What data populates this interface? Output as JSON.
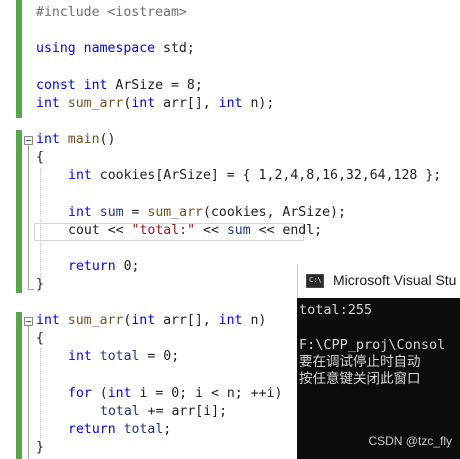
{
  "editor": {
    "lines": {
      "l1_pp": "#include <iostream>",
      "l3_kw": "using namespace",
      "l3_rest": " std;",
      "l5_kw1": "const",
      "l5_kw2": "int",
      "l5_rest": " ArSize = 8;",
      "l6_kw": "int",
      "l6_fn": "sum_arr",
      "l6_p1": "(",
      "l6_kw2": "int",
      "l6_p2": " arr[], ",
      "l6_kw3": "int",
      "l6_p3": " n);",
      "main_kw": "int",
      "main_fn": "main",
      "main_p": "()",
      "brace_open": "{",
      "c1_kw": "int",
      "c1_rest": " cookies[ArSize] = { 1,2,4,8,16,32,64,128 };",
      "c2_kw": "int",
      "c2_id": " sum",
      "c2_p1": " = ",
      "c2_fn": "sum_arr",
      "c2_p2": "(cookies, ArSize);",
      "c3_a": "cout << ",
      "c3_str": "\"total:\"",
      "c3_b": " << ",
      "c3_id": "sum",
      "c3_c": " << endl;",
      "c4_kw": "return",
      "c4_rest": " 0;",
      "brace_close": "}",
      "f_kw": "int",
      "f_fn": "sum_arr",
      "f_p1": "(",
      "f_kw2": "int",
      "f_p2": " arr[], ",
      "f_kw3": "int",
      "f_p3": " n)",
      "f1_kw": "int",
      "f1_id": " total",
      "f1_rest": " = 0;",
      "f2_kw": "for",
      "f2_p1": " (",
      "f2_kw2": "int",
      "f2_rest": " i = 0; i < n; ++i)",
      "f3_id": "total",
      "f3_rest": " += arr[i];",
      "f4_kw": "return",
      "f4_id": " total",
      "f4_rest": ";"
    }
  },
  "console": {
    "title": "Microsoft Visual Stu",
    "output_line1": "total:255",
    "output_line2": "F:\\CPP_proj\\Consol",
    "output_line3": "要在调试停止时自动",
    "output_line4": "按任意键关闭此窗口"
  },
  "watermark": "CSDN @tzc_fly",
  "colors": {
    "keyword": "#0000ff",
    "string": "#a31515",
    "change_bar": "#57a64a",
    "console_bg": "#0c0c0c"
  }
}
